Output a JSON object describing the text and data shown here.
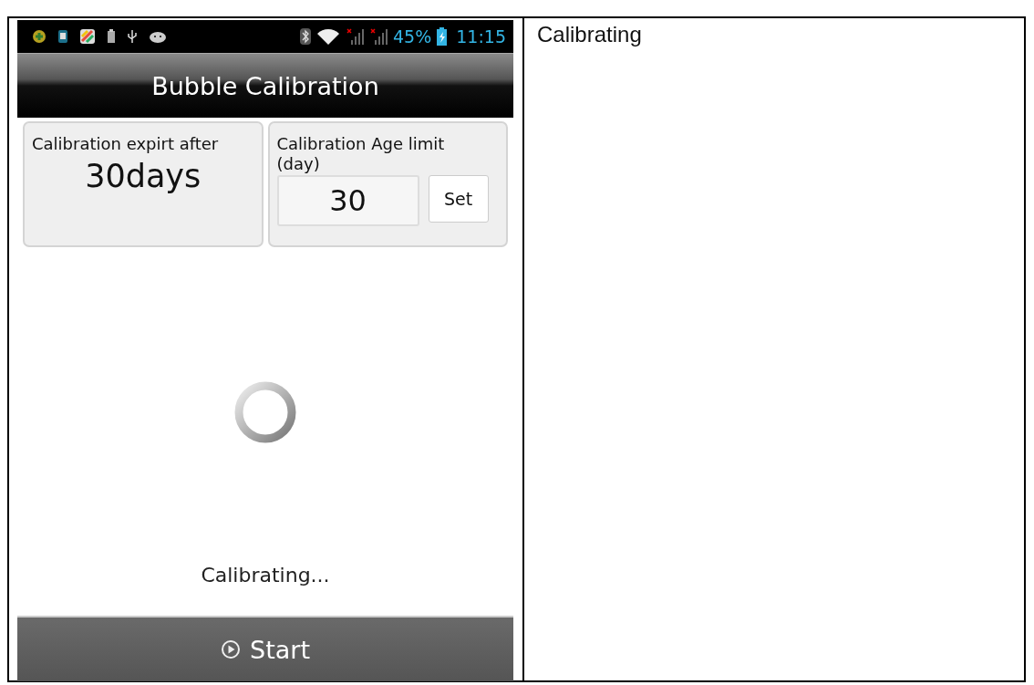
{
  "status_bar": {
    "battery": "45%",
    "time": "11:15"
  },
  "app": {
    "title": "Bubble Calibration",
    "expiry_card": {
      "label": "Calibration expirt after",
      "value": "30days"
    },
    "limit_card": {
      "label": "Calibration Age limit (day)",
      "value": "30",
      "button": "Set"
    },
    "status_text": "Calibrating...",
    "start_button": "Start"
  },
  "description": "Calibrating"
}
